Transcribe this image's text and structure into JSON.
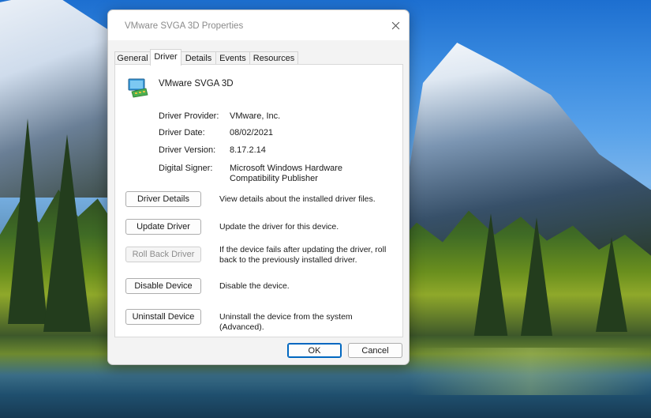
{
  "dialog": {
    "title": "VMware SVGA 3D Properties",
    "close_icon": "close-icon"
  },
  "tabs": [
    {
      "label": "General",
      "active": false
    },
    {
      "label": "Driver",
      "active": true
    },
    {
      "label": "Details",
      "active": false
    },
    {
      "label": "Events",
      "active": false
    },
    {
      "label": "Resources",
      "active": false
    }
  ],
  "device": {
    "icon": "display-adapter-icon",
    "name": "VMware SVGA 3D"
  },
  "info": {
    "provider_label": "Driver Provider:",
    "provider_value": "VMware, Inc.",
    "date_label": "Driver Date:",
    "date_value": "08/02/2021",
    "version_label": "Driver Version:",
    "version_value": "8.17.2.14",
    "signer_label": "Digital Signer:",
    "signer_value": "Microsoft Windows Hardware Compatibility Publisher"
  },
  "actions": [
    {
      "label": "Driver Details",
      "description": "View details about the installed driver files.",
      "enabled": true
    },
    {
      "label": "Update Driver",
      "description": "Update the driver for this device.",
      "enabled": true
    },
    {
      "label": "Roll Back Driver",
      "description": "If the device fails after updating the driver, roll back to the previously installed driver.",
      "enabled": false
    },
    {
      "label": "Disable Device",
      "description": "Disable the device.",
      "enabled": true
    },
    {
      "label": "Uninstall Device",
      "description": "Uninstall the device from the system (Advanced).",
      "enabled": true
    }
  ],
  "footer": {
    "ok_label": "OK",
    "cancel_label": "Cancel"
  },
  "colors": {
    "accent": "#0067c0",
    "dialog_bg": "#f3f3f3",
    "panel_bg": "#ffffff"
  }
}
